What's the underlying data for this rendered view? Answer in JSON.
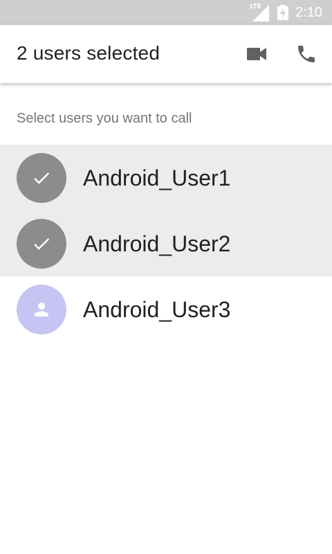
{
  "status_bar": {
    "network_label": "LTE",
    "time": "2:10"
  },
  "app_bar": {
    "title": "2 users selected",
    "actions": [
      {
        "name": "video-call",
        "icon": "video-camera-icon"
      },
      {
        "name": "voice-call",
        "icon": "phone-icon"
      }
    ]
  },
  "hint": "Select users you want to call",
  "users": [
    {
      "name": "Android_User1",
      "selected": true
    },
    {
      "name": "Android_User2",
      "selected": true
    },
    {
      "name": "Android_User3",
      "selected": false
    }
  ],
  "colors": {
    "status_bar": "#cfcfcf",
    "selected_row": "#ececec",
    "checked_avatar": "#8c8c8c",
    "default_avatar": "#c6c4f2",
    "icon": "#616161"
  }
}
